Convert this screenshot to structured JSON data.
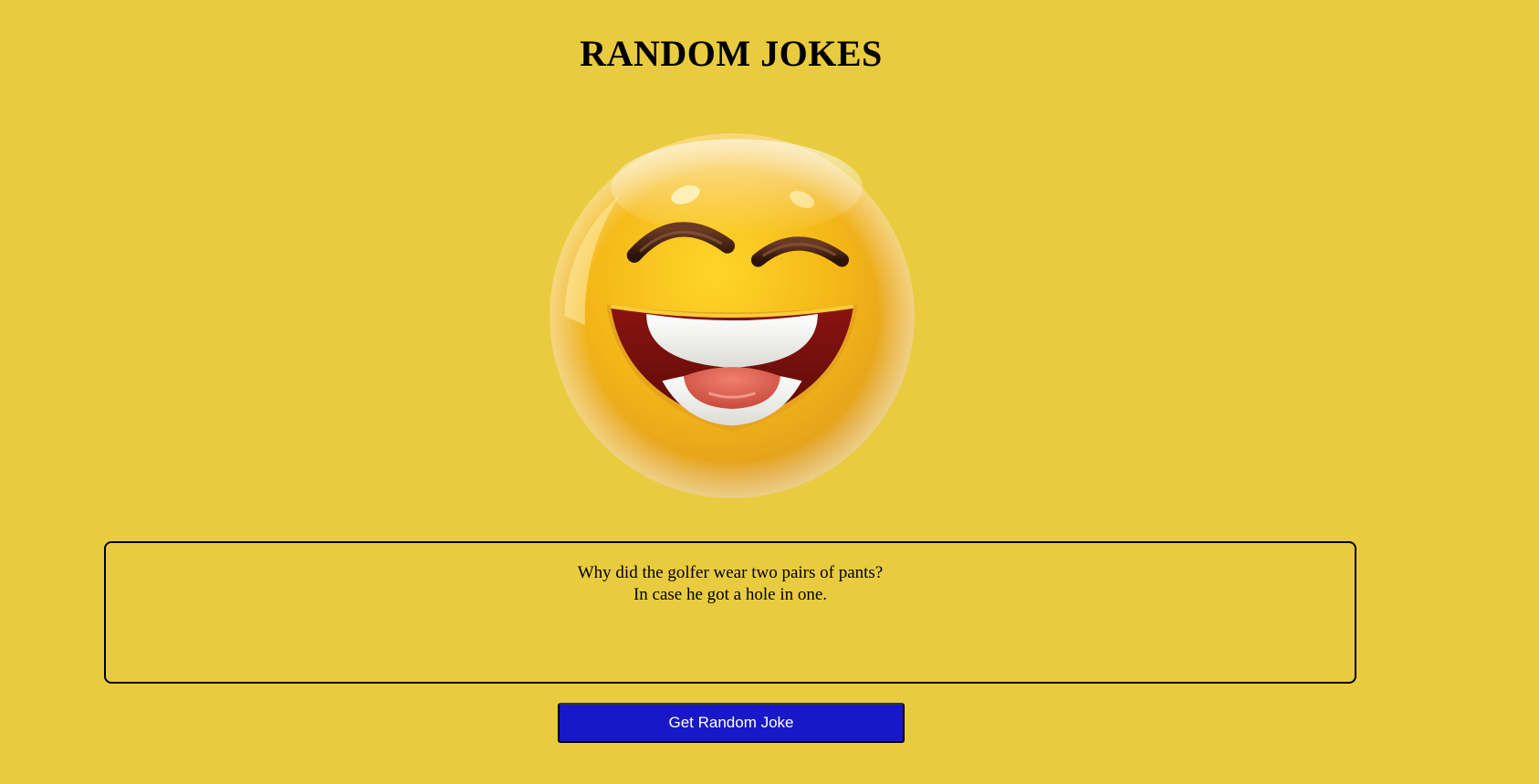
{
  "header": {
    "title": "RANDOM JOKES"
  },
  "image": {
    "icon": "laughing-emoji-icon"
  },
  "joke": {
    "setup": "Why did the golfer wear two pairs of pants?",
    "punchline": "In case he got a hole in one."
  },
  "actions": {
    "get_joke_label": "Get Random Joke"
  },
  "colors": {
    "background": "#e9cb3f",
    "button": "#1818c8",
    "button_text": "#ffffff",
    "border": "#000000"
  }
}
